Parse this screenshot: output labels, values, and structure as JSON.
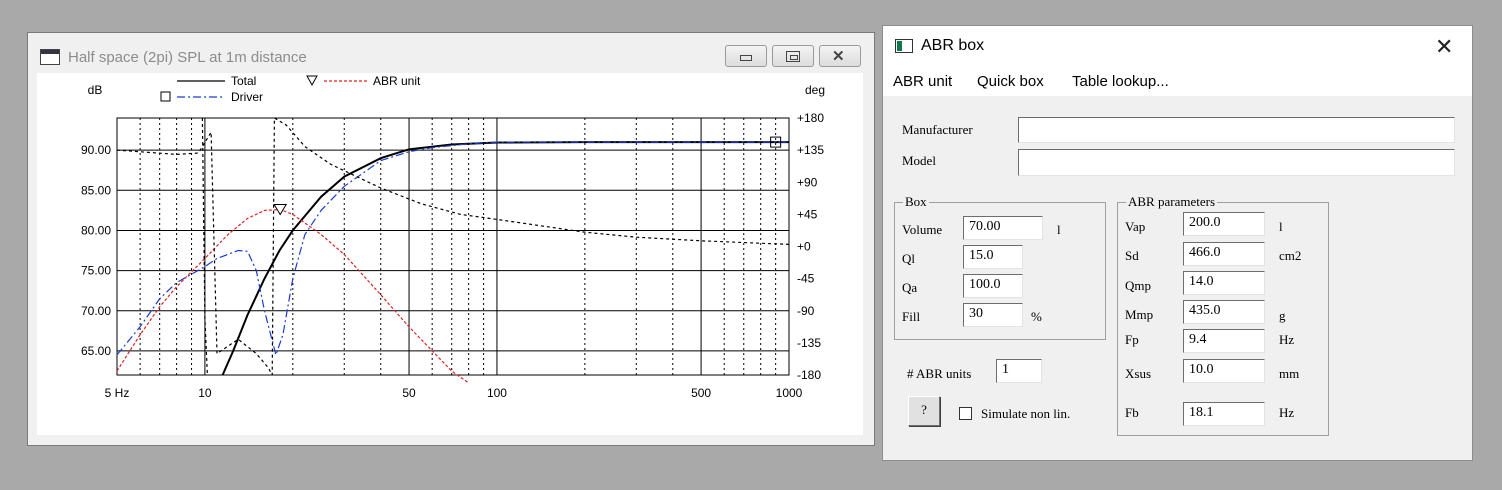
{
  "spl_window": {
    "title": "Half space (2pi) SPL at 1m distance",
    "icons": [
      "graph-app-icon",
      "minimize-icon",
      "maximize-icon",
      "close-icon"
    ]
  },
  "chart_data": {
    "type": "line",
    "title": "",
    "xlabel": "",
    "ylabel": "dB",
    "y2label": "deg",
    "xscale": "log",
    "xlim": [
      5,
      1000
    ],
    "ylim": [
      62,
      94
    ],
    "y2lim": [
      -180,
      180
    ],
    "x_ticks": [
      "5 Hz",
      "10",
      "50",
      "100",
      "500",
      "1000"
    ],
    "y_ticks": [
      "90.00",
      "85.00",
      "80.00",
      "75.00",
      "70.00",
      "65.00"
    ],
    "y2_ticks": [
      "+180",
      "+135",
      "+90",
      "+45",
      "+0",
      "-45",
      "-90",
      "-135",
      "-180"
    ],
    "grid": true,
    "legend": [
      "Total",
      "Driver",
      "ABR unit"
    ],
    "series": [
      {
        "name": "Total",
        "axis": "left",
        "color": "#000000",
        "style": "solid",
        "points": [
          [
            11.5,
            62
          ],
          [
            12.5,
            65
          ],
          [
            14,
            69.5
          ],
          [
            16,
            74
          ],
          [
            18,
            77.5
          ],
          [
            20,
            80
          ],
          [
            25,
            84.2
          ],
          [
            30,
            86.7
          ],
          [
            40,
            89
          ],
          [
            50,
            90.1
          ],
          [
            70,
            90.7
          ],
          [
            100,
            90.95
          ],
          [
            200,
            91
          ],
          [
            500,
            91
          ],
          [
            1000,
            91
          ]
        ]
      },
      {
        "name": "Driver",
        "axis": "left",
        "color": "#1a3bd1",
        "style": "dashdot",
        "points": [
          [
            5,
            64.5
          ],
          [
            6,
            68
          ],
          [
            7,
            71.5
          ],
          [
            8,
            73.5
          ],
          [
            10,
            75.5
          ],
          [
            11,
            76.5
          ],
          [
            13,
            77.5
          ],
          [
            14,
            77.4
          ],
          [
            15,
            75
          ],
          [
            16,
            70
          ],
          [
            16.8,
            67
          ],
          [
            17.5,
            64.5
          ],
          [
            18.5,
            67
          ],
          [
            20,
            74
          ],
          [
            22,
            79.5
          ],
          [
            25,
            82.5
          ],
          [
            30,
            85.5
          ],
          [
            40,
            88.7
          ],
          [
            50,
            89.8
          ],
          [
            60,
            90.3
          ],
          [
            80,
            90.8
          ],
          [
            100,
            91
          ],
          [
            150,
            91
          ],
          [
            300,
            91
          ],
          [
            650,
            91
          ],
          [
            1000,
            91
          ]
        ]
      },
      {
        "name": "ABR unit",
        "axis": "left",
        "color": "#dd2222",
        "style": "dotted",
        "points": [
          [
            5,
            62.5
          ],
          [
            6,
            67
          ],
          [
            7,
            70.5
          ],
          [
            8,
            73
          ],
          [
            10,
            76.5
          ],
          [
            12,
            79.5
          ],
          [
            14,
            81.5
          ],
          [
            16,
            82.5
          ],
          [
            18.1,
            82.6
          ],
          [
            20,
            82
          ],
          [
            25,
            79.5
          ],
          [
            30,
            77
          ],
          [
            40,
            72
          ],
          [
            50,
            68
          ],
          [
            60,
            65
          ],
          [
            70,
            62.5
          ],
          [
            80,
            61
          ]
        ]
      },
      {
        "name": "Total phase",
        "axis": "right",
        "color": "#000000",
        "style": "dashed",
        "points": [
          [
            5,
            135
          ],
          [
            8,
            129
          ],
          [
            9.5,
            131
          ],
          [
            10.5,
            160
          ],
          [
            11,
            -150
          ],
          [
            13,
            -130
          ],
          [
            15,
            -150
          ],
          [
            16.5,
            -170
          ],
          [
            17,
            -180
          ],
          [
            17.3,
            180
          ],
          [
            19,
            170
          ],
          [
            22,
            140
          ],
          [
            27,
            115
          ],
          [
            40,
            82
          ],
          [
            55,
            60
          ],
          [
            75,
            45
          ],
          [
            100,
            38
          ],
          [
            200,
            20
          ],
          [
            300,
            13
          ],
          [
            500,
            8
          ],
          [
            1000,
            3
          ]
        ]
      },
      {
        "name": "Driver phase",
        "axis": "right",
        "color": "#000000",
        "style": "dashed",
        "points": [
          [
            9.8,
            180
          ],
          [
            10,
            -100
          ],
          [
            10.2,
            -180
          ]
        ]
      }
    ],
    "markers": [
      {
        "series": "ABR unit",
        "shape": "triangle-down",
        "x": 18.1,
        "y": 82.6
      },
      {
        "series": "Driver",
        "shape": "square",
        "x": 900,
        "y": 91
      }
    ]
  },
  "abr_window": {
    "title": "ABR box",
    "menu": [
      "ABR unit",
      "Quick box",
      "Table lookup..."
    ],
    "manufacturer_label": "Manufacturer",
    "manufacturer_value": "",
    "model_label": "Model",
    "model_value": "",
    "box": {
      "title": "Box",
      "volume_label": "Volume",
      "volume_value": "70.00",
      "volume_unit": "l",
      "ql_label": "Ql",
      "ql_value": "15.0",
      "qa_label": "Qa",
      "qa_value": "100.0",
      "fill_label": "Fill",
      "fill_value": "30",
      "fill_unit": "%"
    },
    "abr_units_label": "# ABR units",
    "abr_units_value": "1",
    "help_button": "?",
    "simulate_label": "Simulate non lin.",
    "simulate_checked": false,
    "params": {
      "title": "ABR parameters",
      "vap_label": "Vap",
      "vap_value": "200.0",
      "vap_unit": "l",
      "sd_label": "Sd",
      "sd_value": "466.0",
      "sd_unit": "cm2",
      "qmp_label": "Qmp",
      "qmp_value": "14.0",
      "mmp_label": "Mmp",
      "mmp_value": "435.0",
      "mmp_unit": "g",
      "fp_label": "Fp",
      "fp_value": "9.4",
      "fp_unit": "Hz",
      "xsus_label": "Xsus",
      "xsus_value": "10.0",
      "xsus_unit": "mm",
      "fb_label": "Fb",
      "fb_value": "18.1",
      "fb_unit": "Hz"
    }
  }
}
